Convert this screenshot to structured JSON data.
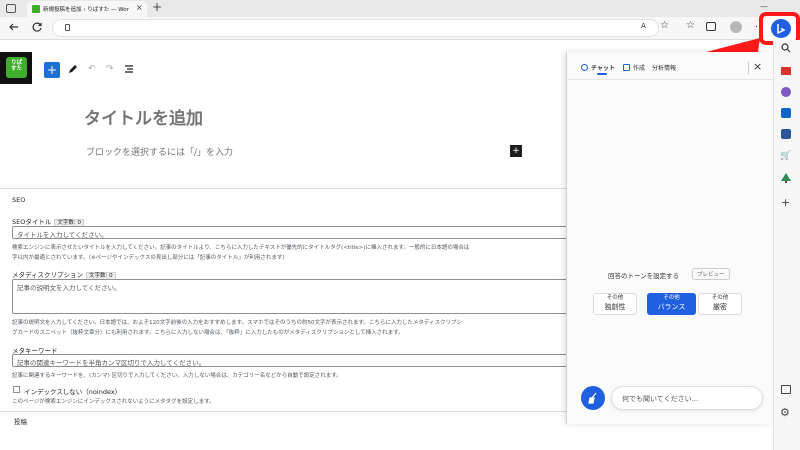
{
  "browser": {
    "tab_title": "新規投稿を追加 ‹ りばすた — Wor",
    "new_tab_symbol": "+",
    "window_minimize": "—",
    "read_aloud_icon": "A"
  },
  "site": {
    "logo_text": "りば\nすた"
  },
  "editor": {
    "title_placeholder": "タイトルを追加",
    "block_placeholder": "ブロックを選択するには「/」を入力",
    "add_block_symbol": "+"
  },
  "seo": {
    "section_title": "SEO",
    "seo_title_label": "SEOタイトル",
    "seo_title_counter": "文字数: 0",
    "seo_title_placeholder": "タイトルを入力してください。",
    "seo_title_help_1": "検索エンジンに表示させたいタイトルを入力してください。記事のタイトルより、こちらに入力したテキストが優先的にタイトルタグ(<title>)に挿入されます。一般的に日本語の場合は",
    "seo_title_help_2": "字以内が最適とされています。（※ページやインデックスの見出し部分には「記事のタイトル」が利用されます）",
    "meta_desc_label": "メタディスクリプション",
    "meta_desc_counter": "文字数: 0",
    "meta_desc_placeholder": "記事の説明文を入力してください。",
    "meta_desc_help_1": "記事の説明文を入力してください。日本語では、およそ120文字前後の入力をおすすめします。スマホではそのうちの約50文字が表示されます。こちらに入力したメタディスクリプシ",
    "meta_desc_help_2": "グカードのスニペット（抜粋文章分）にも利用されます。こちらに入力しない場合は、「抜粋」に入力したものがメタディスクリプションとして挿入されます。",
    "meta_kw_label": "メタキーワード",
    "meta_kw_placeholder": "記事の関連キーワードを半角カンマ区切りで入力してください。",
    "meta_kw_help": "記事に関連するキーワードを、(カンマ) 区切りで入力してください。入力しない場合は、カテゴリー名などから自動で設定されます。",
    "noindex_label": "インデックスしない（noindex）",
    "noindex_help": "このページが検索エンジンにインデックスされないようにメタタグを設定します。",
    "next_section": "投稿"
  },
  "panel": {
    "tabs": [
      {
        "label": "チャット"
      },
      {
        "label": "作成"
      },
      {
        "label": "分析情報"
      }
    ],
    "tone_heading": "回答のトーンを設定する",
    "preview_badge": "プレビュー",
    "tones": [
      {
        "small": "その他",
        "big": "独創性"
      },
      {
        "small": "その他",
        "big": "バランス"
      },
      {
        "small": "その他",
        "big": "厳密"
      }
    ],
    "input_placeholder": "何でも聞いてください..."
  },
  "colors": {
    "wp_blue": "#1e70d2",
    "bing_blue": "#1f5fe0",
    "highlight_red": "#ff1a1a",
    "logo_green": "#3fae2a"
  }
}
